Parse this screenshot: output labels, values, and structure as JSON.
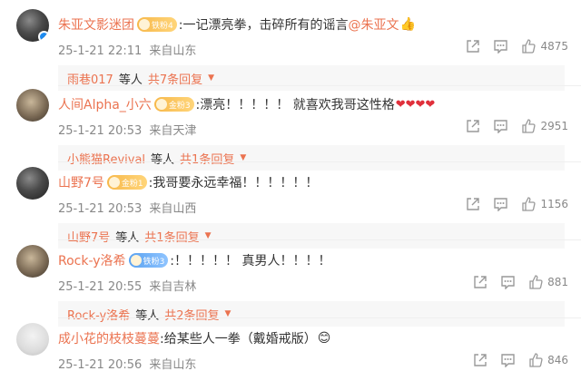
{
  "comments": [
    {
      "nick": "朱亚文影迷团",
      "badge": "铁粉4",
      "text": ":一记漂亮拳，击碎所有的谣言",
      "mention": "@朱亚文",
      "emoji": "👍",
      "date": "25-1-21 22:11",
      "location": "来自山东",
      "likes": "4875",
      "reply_name": "雨巷017",
      "reply_mid": "等人",
      "reply_count": "共7条回复"
    },
    {
      "nick": "人间Alpha_小六",
      "badge": "金粉3",
      "text": ":漂亮！！！！！ 就喜欢我哥这性格",
      "emoji": "❤❤❤❤",
      "date": "25-1-21 20:53",
      "location": "来自天津",
      "likes": "2951",
      "reply_name": "小熊猫Revival",
      "reply_mid": "等人",
      "reply_count": "共1条回复"
    },
    {
      "nick": "山野7号",
      "badge": "金粉1",
      "text": ":我哥要永远幸福！！！！！！",
      "date": "25-1-21 20:53",
      "location": "来自山西",
      "likes": "1156",
      "reply_name": "山野7号",
      "reply_mid": "等人",
      "reply_count": "共1条回复"
    },
    {
      "nick": "Rock-y洛希",
      "badge": "铁粉3",
      "text": ":！！！！！ 真男人！！！！",
      "date": "25-1-21 20:55",
      "location": "来自吉林",
      "likes": "881",
      "reply_name": "Rock-y洛希",
      "reply_mid": "等人",
      "reply_count": "共2条回复"
    },
    {
      "nick": "成小花的枝枝蔓蔓",
      "text": ":给某些人一拳（戴婚戒版）",
      "emoji": "😊",
      "date": "25-1-21 20:56",
      "location": "来自山东",
      "likes": "846"
    }
  ],
  "colors": {
    "accent": "#eb7350",
    "meta": "#888888",
    "reply_bg": "#f7f7f7",
    "verified": "#1e8bf0"
  }
}
